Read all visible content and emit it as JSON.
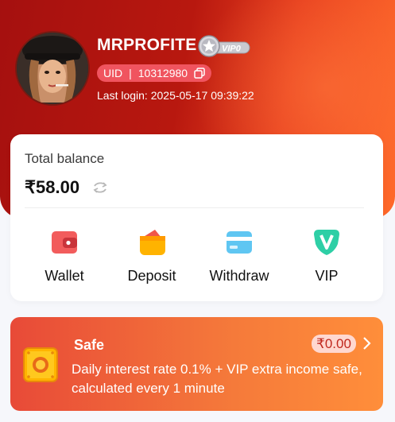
{
  "profile": {
    "username": "MRPROFITE",
    "vip_badge": "VIP0",
    "uid_label": "UID",
    "uid_separator": "|",
    "uid_value": "10312980",
    "last_login": "Last login: 2025-05-17 09:39:22"
  },
  "balance": {
    "label": "Total balance",
    "value": "₹58.00"
  },
  "actions": [
    {
      "label": "Wallet",
      "icon": "wallet-icon"
    },
    {
      "label": "Deposit",
      "icon": "deposit-icon"
    },
    {
      "label": "Withdraw",
      "icon": "withdraw-icon"
    },
    {
      "label": "VIP",
      "icon": "vip-icon"
    }
  ],
  "safe": {
    "title": "Safe",
    "amount": "₹0.00",
    "description": "Daily interest rate 0.1% + VIP extra income safe, calculated every 1 minute"
  },
  "colors": {
    "hero_dark": "#a5100f",
    "hero_light": "#ff6a2a",
    "uid_pill": "#f0545f",
    "safe_start": "#e84a38",
    "safe_end": "#ff8e3a"
  }
}
